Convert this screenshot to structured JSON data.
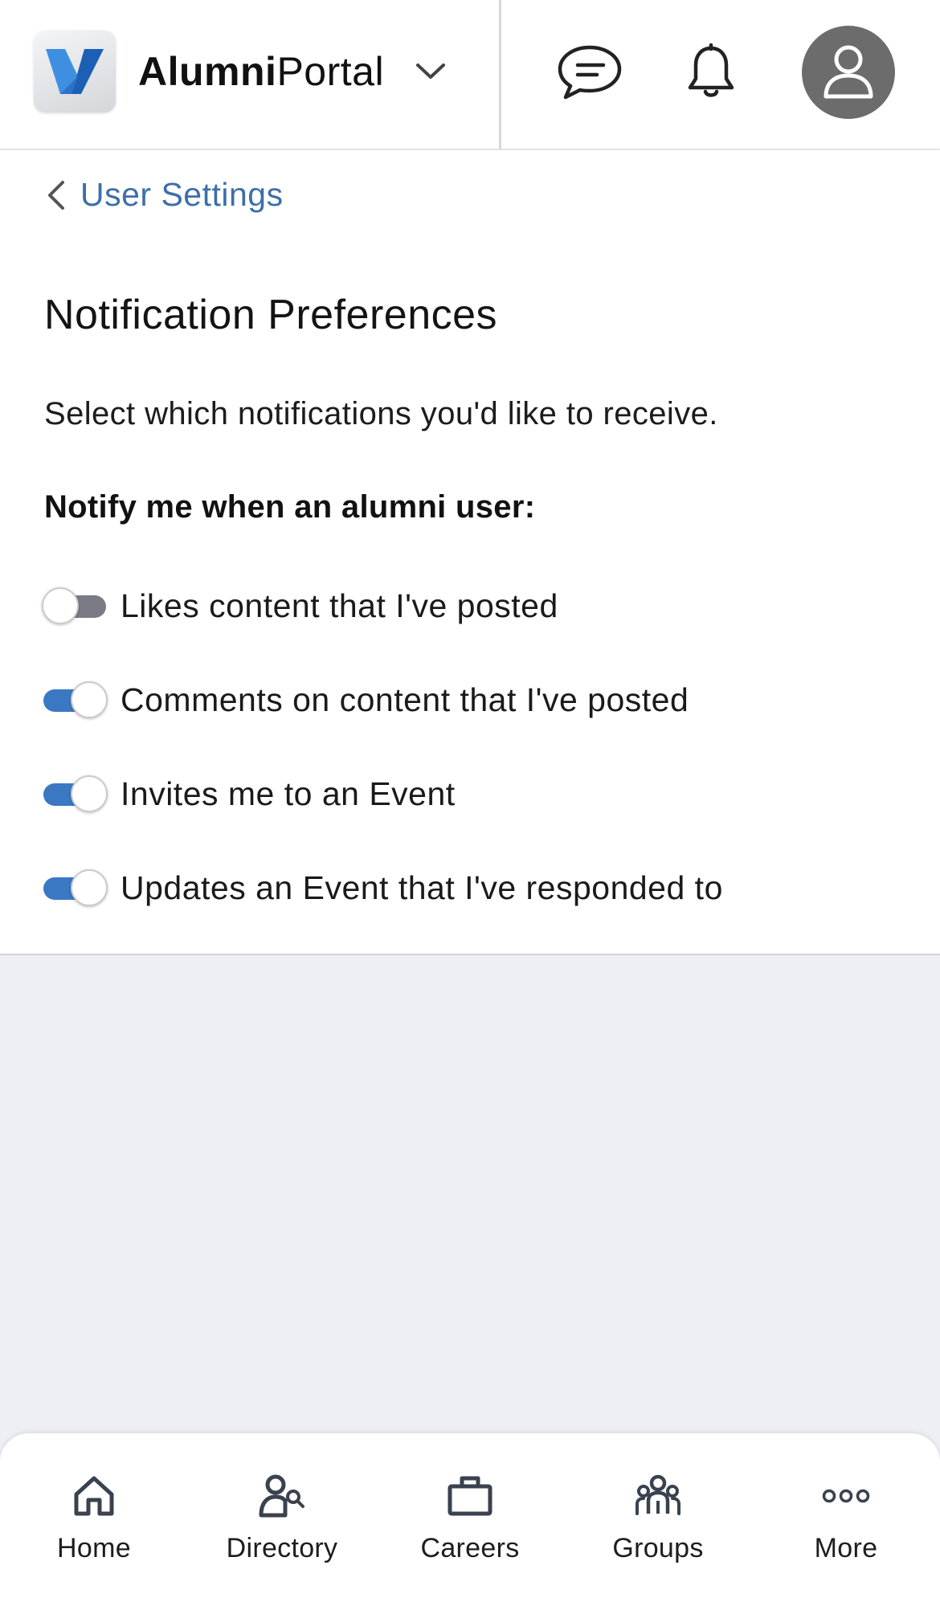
{
  "header": {
    "app_name_bold": "Alumni",
    "app_name_light": "Portal",
    "icons": [
      "logo-icon",
      "chevron-down-icon",
      "chat-icon",
      "bell-icon",
      "user-avatar-icon"
    ]
  },
  "breadcrumb": {
    "back_label": "User Settings"
  },
  "page": {
    "title": "Notification Preferences",
    "description": "Select which notifications you'd like to receive.",
    "subheading": "Notify me when an alumni user:"
  },
  "preferences": [
    {
      "label": "Likes content that I've posted",
      "enabled": false
    },
    {
      "label": "Comments on content that I've posted",
      "enabled": true
    },
    {
      "label": "Invites me to an Event",
      "enabled": true
    },
    {
      "label": "Updates an Event that I've responded to",
      "enabled": true
    }
  ],
  "bottom_nav": [
    {
      "label": "Home",
      "icon": "home-icon"
    },
    {
      "label": "Directory",
      "icon": "directory-icon"
    },
    {
      "label": "Careers",
      "icon": "briefcase-icon"
    },
    {
      "label": "Groups",
      "icon": "groups-icon"
    },
    {
      "label": "More",
      "icon": "more-icon"
    }
  ],
  "colors": {
    "accent": "#3a78c3",
    "link": "#3d6fa8",
    "toggle_off": "#7a7b84",
    "background": "#edeff4"
  }
}
